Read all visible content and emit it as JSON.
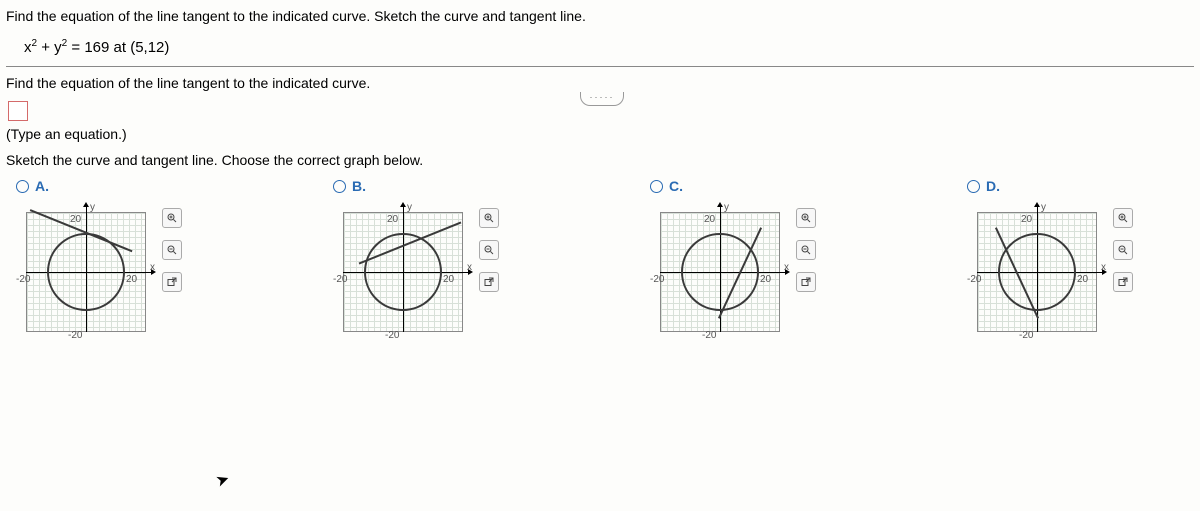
{
  "question": {
    "intro": "Find the equation of the line tangent to the indicated curve. Sketch the curve and tangent line.",
    "equation_html": "x² + y² = 169 at (5,12)",
    "prompt": "Find the equation of the line tangent to the indicated curve.",
    "hint": "(Type an equation.)",
    "sketch_prompt": "Sketch the curve and tangent line. Choose the correct graph below."
  },
  "axes": {
    "x": "x",
    "y": "y",
    "xmax": "20",
    "xmin": "-20",
    "ymax": "20",
    "ymin": "-20"
  },
  "choices": [
    {
      "label": "A."
    },
    {
      "label": "B."
    },
    {
      "label": "C."
    },
    {
      "label": "D."
    }
  ],
  "tools": {
    "zoom_in": "zoom-in",
    "zoom_out": "zoom-out",
    "popout": "popout"
  },
  "separator_glyph": "·····"
}
